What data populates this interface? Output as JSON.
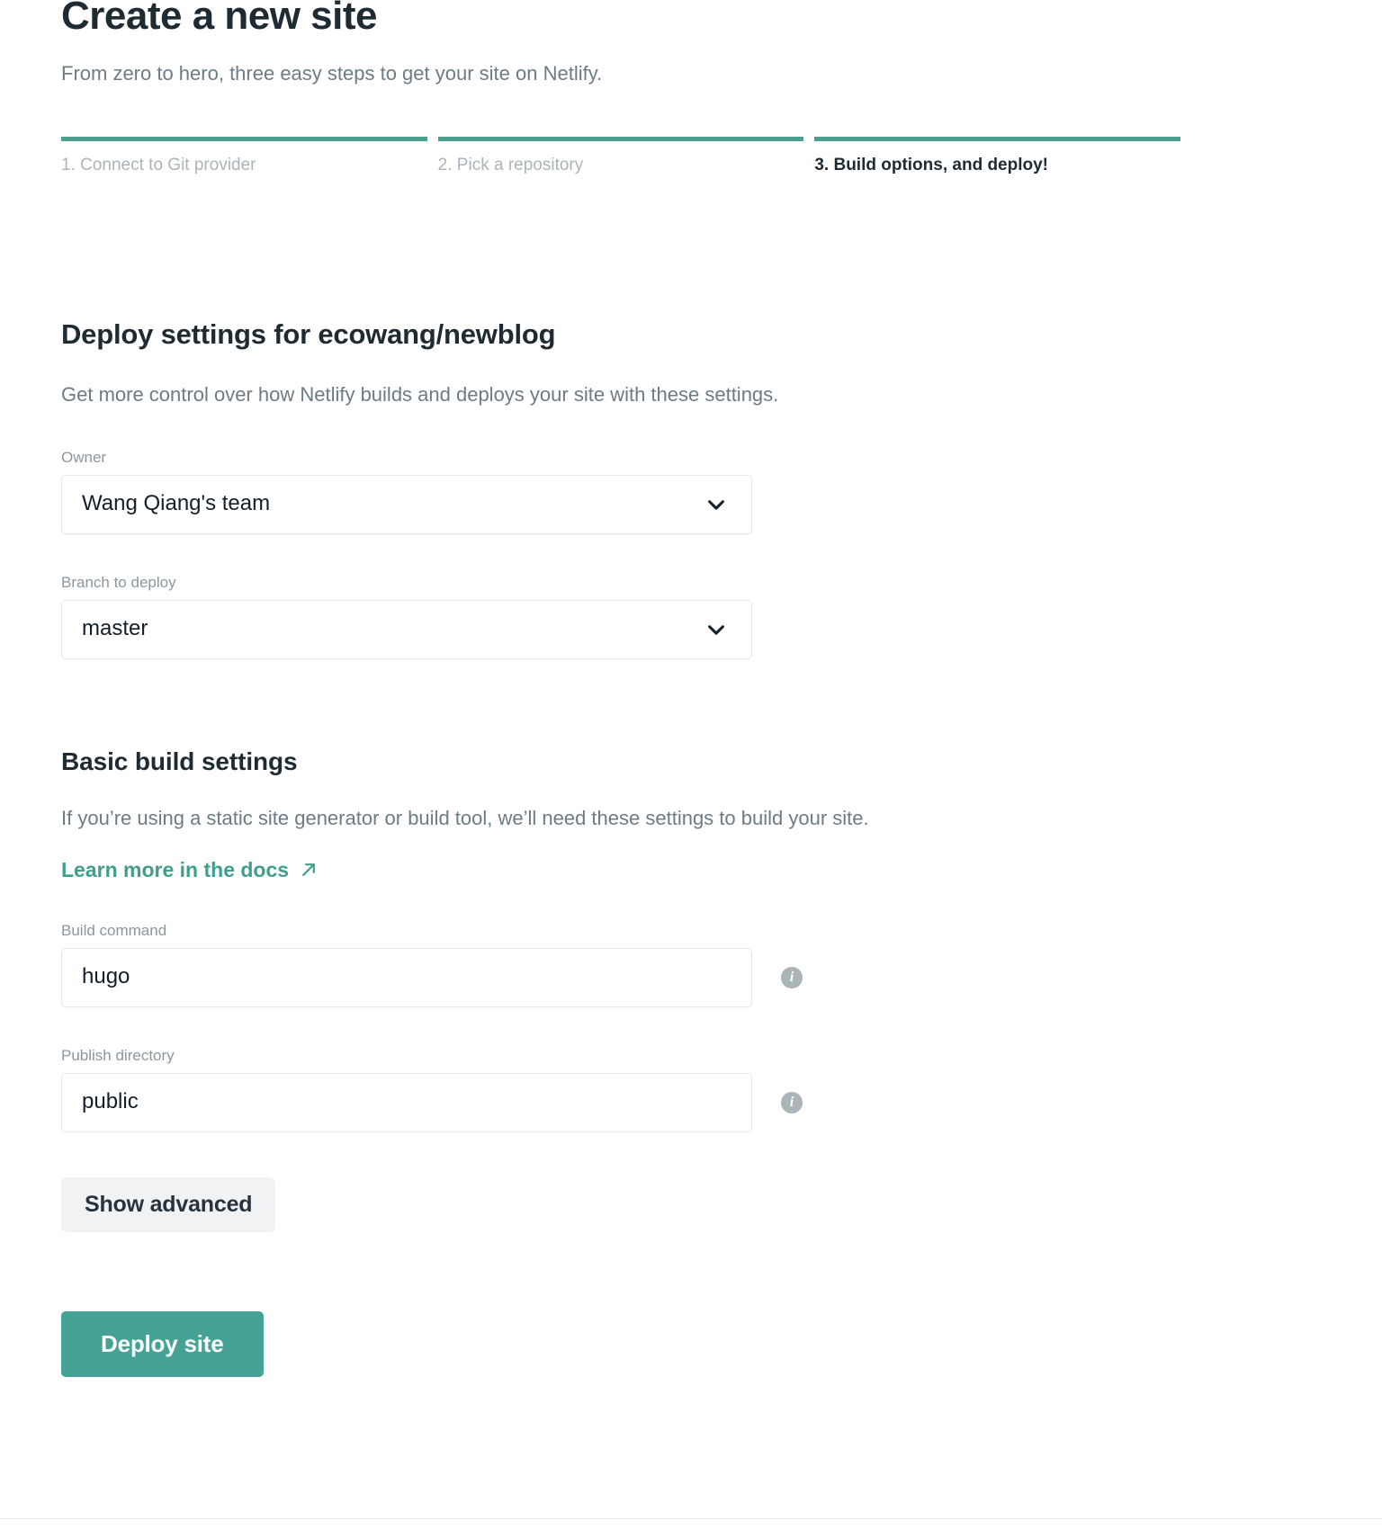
{
  "wizard": {
    "title": "Create a new site",
    "subtitle": "From zero to hero, three easy steps to get your site on Netlify.",
    "steps": [
      {
        "label": "1. Connect to Git provider",
        "active": false
      },
      {
        "label": "2. Pick a repository",
        "active": false
      },
      {
        "label": "3. Build options, and deploy!",
        "active": true
      }
    ],
    "accent_color": "#4d9e8f"
  },
  "deploy": {
    "section_title": "Deploy settings for ecowang/newblog",
    "section_desc": "Get more control over how Netlify builds and deploys your site with these settings.",
    "owner": {
      "label": "Owner",
      "value": "Wang Qiang's team",
      "icon": "chevron-down-icon"
    },
    "branch": {
      "label": "Branch to deploy",
      "value": "master",
      "icon": "chevron-down-icon"
    }
  },
  "build": {
    "title": "Basic build settings",
    "desc": "If you’re using a static site generator or build tool, we’ll need these settings to build your site.",
    "docs_link": "Learn more in the docs",
    "docs_link_icon": "external-link-arrow-icon",
    "docs_link_color": "#3f9e8d",
    "build_command": {
      "label": "Build command",
      "value": "hugo",
      "placeholder": "",
      "info_icon": "info-icon"
    },
    "publish_directory": {
      "label": "Publish directory",
      "value": "public",
      "placeholder": "",
      "info_icon": "info-icon"
    },
    "show_advanced_label": "Show advanced"
  },
  "actions": {
    "deploy_label": "Deploy site",
    "deploy_color": "#46a295"
  }
}
